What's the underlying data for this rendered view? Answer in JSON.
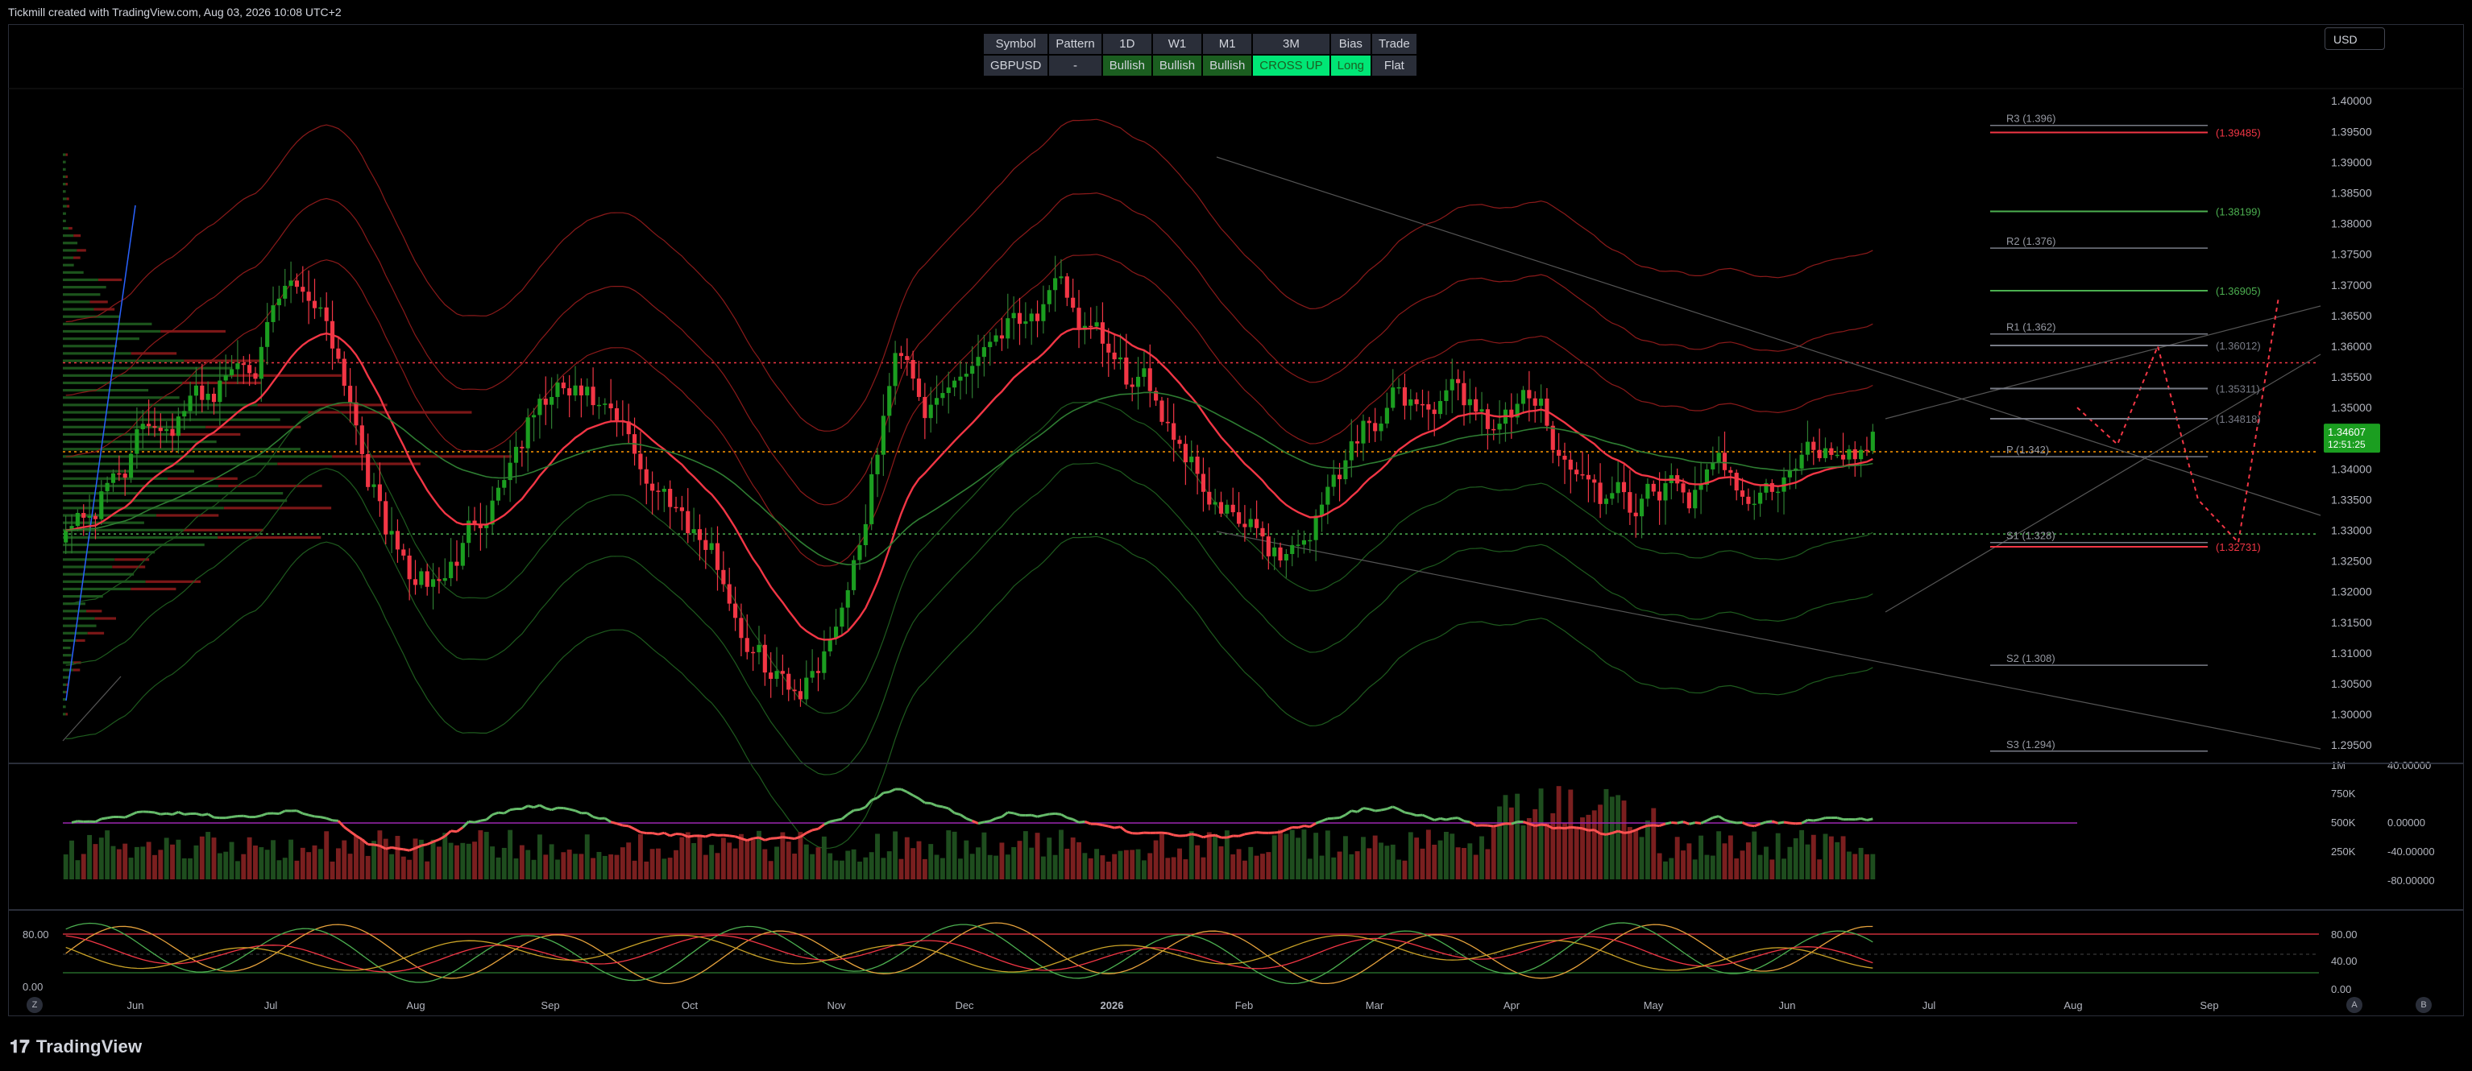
{
  "header": {
    "text": "Tickmill created with TradingView.com, Aug 03, 2026 10:08 UTC+2"
  },
  "brand": {
    "name": "TradingView"
  },
  "currency": {
    "label": "USD"
  },
  "controls": {
    "z": "Z",
    "a": "A",
    "b": "B"
  },
  "status_table": {
    "headers": [
      "Symbol",
      "Pattern",
      "1D",
      "W1",
      "M1",
      "3M",
      "Bias",
      "Trade"
    ],
    "values": [
      "GBPUSD",
      "-",
      "Bullish",
      "Bullish",
      "Bullish",
      "CROSS UP",
      "Long",
      "Flat"
    ],
    "colors": [
      "#2a2e39",
      "#2a2e39",
      "#1b5e20",
      "#1b5e20",
      "#1b5e20",
      "#00e676",
      "#00e676",
      "#2a2e39"
    ],
    "text_colors": [
      "#d1d4dc",
      "#d1d4dc",
      "#d1d4dc",
      "#d1d4dc",
      "#d1d4dc",
      "#1b5e20",
      "#1b5e20",
      "#d1d4dc"
    ]
  },
  "current_price": {
    "value": "1.34607",
    "countdown": "12:51:25"
  },
  "price_axis": {
    "labels": [
      "1.40000",
      "1.39500",
      "1.39000",
      "1.38500",
      "1.38000",
      "1.37500",
      "1.37000",
      "1.36500",
      "1.36000",
      "1.35500",
      "1.35000",
      "1.34500",
      "1.34000",
      "1.33500",
      "1.33000",
      "1.32500",
      "1.32000",
      "1.31500",
      "1.31000",
      "1.30500",
      "1.30000",
      "1.29500"
    ],
    "values": [
      1.4,
      1.395,
      1.39,
      1.385,
      1.38,
      1.375,
      1.37,
      1.365,
      1.36,
      1.355,
      1.35,
      1.345,
      1.34,
      1.335,
      1.33,
      1.325,
      1.32,
      1.315,
      1.31,
      1.305,
      1.3,
      1.295
    ]
  },
  "volume_axis": {
    "labels": [
      "1M",
      "750K",
      "500K",
      "250K"
    ]
  },
  "rsi_axis": {
    "labels": [
      "40.00000",
      "0.00000",
      "-40.00000",
      "-80.00000"
    ]
  },
  "stoch_axis": {
    "right_labels": [
      "80.00",
      "40.00",
      "0.00"
    ],
    "left_labels": [
      "80.00",
      "0.00"
    ]
  },
  "time_axis": {
    "labels": [
      "Jun",
      "Jul",
      "Aug",
      "Sep",
      "Oct",
      "Nov",
      "Dec",
      "2026",
      "Feb",
      "Mar",
      "Apr",
      "May",
      "Jun",
      "Jul",
      "Aug",
      "Sep"
    ]
  },
  "pivots": [
    {
      "label": "R3 (1.396)",
      "value": 1.396,
      "color": "#9598a1"
    },
    {
      "label": "R2 (1.376)",
      "value": 1.376,
      "color": "#9598a1"
    },
    {
      "label": "R1 (1.362)",
      "value": 1.362,
      "color": "#9598a1"
    },
    {
      "label": "P (1.342)",
      "value": 1.342,
      "color": "#9598a1"
    },
    {
      "label": "S1 (1.328)",
      "value": 1.328,
      "color": "#9598a1"
    },
    {
      "label": "S2 (1.308)",
      "value": 1.308,
      "color": "#9598a1"
    },
    {
      "label": "S3 (1.294)",
      "value": 1.294,
      "color": "#9598a1"
    }
  ],
  "levels": [
    {
      "label": "(1.39485)",
      "value": 1.39485,
      "color": "#f23645"
    },
    {
      "label": "(1.38199)",
      "value": 1.38199,
      "color": "#4caf50"
    },
    {
      "label": "(1.36905)",
      "value": 1.36905,
      "color": "#4caf50"
    },
    {
      "label": "(1.36012)",
      "value": 1.36012,
      "color": "#787b86"
    },
    {
      "label": "(1.35311)",
      "value": 1.35311,
      "color": "#787b86"
    },
    {
      "label": "(1.34818)",
      "value": 1.34818,
      "color": "#787b86"
    },
    {
      "label": "(1.32731)",
      "value": 1.32731,
      "color": "#f23645"
    }
  ],
  "chart_data": {
    "type": "candlestick",
    "symbol": "GBPUSD",
    "ylim": [
      1.292,
      1.402
    ],
    "colors": {
      "up": "#1b9e20",
      "down": "#f23645",
      "accent_green": "#00e676",
      "bg": "#000000"
    },
    "horizontal_levels": [
      {
        "value": 1.3573,
        "color": "#f23645",
        "style": "dotted"
      },
      {
        "value": 1.3428,
        "color": "#ff9800",
        "style": "dotted"
      },
      {
        "value": 1.3294,
        "color": "#4caf50",
        "style": "dotted"
      }
    ],
    "monthly_anchor_closes": [
      {
        "month": "May",
        "close": 1.333
      },
      {
        "month": "Jun",
        "close": 1.352
      },
      {
        "month": "Jul",
        "close": 1.368
      },
      {
        "month": "Aug",
        "close": 1.321
      },
      {
        "month": "Sep",
        "close": 1.352
      },
      {
        "month": "Oct",
        "close": 1.335
      },
      {
        "month": "Nov",
        "close": 1.306
      },
      {
        "month": "Dec",
        "close": 1.348
      },
      {
        "month": "Jan",
        "close": 1.37
      },
      {
        "month": "Feb",
        "close": 1.348
      },
      {
        "month": "Mar",
        "close": 1.326
      },
      {
        "month": "Apr",
        "close": 1.352
      },
      {
        "month": "May",
        "close": 1.348
      },
      {
        "month": "Jun",
        "close": 1.332
      },
      {
        "month": "Jul",
        "close": 1.337
      },
      {
        "month": "Aug",
        "close": 1.346
      }
    ],
    "projection_path": [
      1.35,
      1.344,
      1.36,
      1.335,
      1.328,
      1.368
    ],
    "rsi_reference": 0
  }
}
